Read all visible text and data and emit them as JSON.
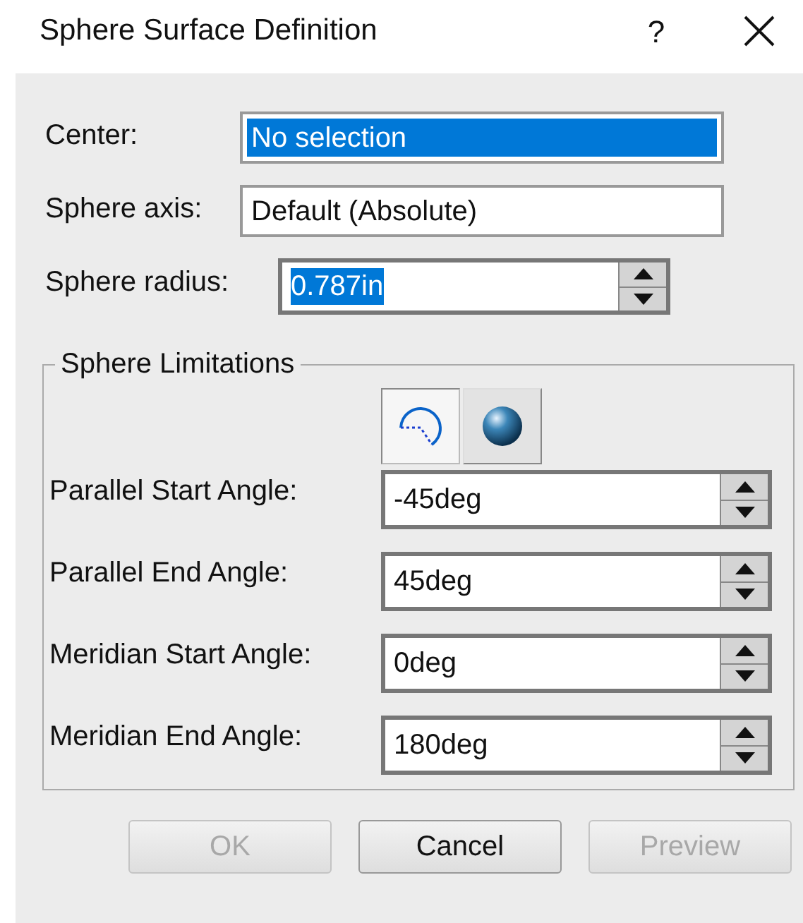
{
  "window": {
    "title": "Sphere Surface Definition",
    "help": "?"
  },
  "fields": [
    {
      "label": "Center:",
      "kind": "text",
      "value": "No selection",
      "selected": true
    },
    {
      "label": "Sphere axis:",
      "kind": "text",
      "value": "Default (Absolute)",
      "selected": false
    },
    {
      "label": "Sphere radius:",
      "kind": "spinner",
      "value": "0.787in",
      "selected": true
    }
  ],
  "limitations": {
    "title": "Sphere Limitations",
    "modes": [
      {
        "kind": "arc",
        "selected": true
      },
      {
        "kind": "sphere",
        "selected": false
      }
    ],
    "angles": [
      {
        "label": "Parallel Start Angle:",
        "value": "-45deg"
      },
      {
        "label": "Parallel End Angle:",
        "value": "45deg"
      },
      {
        "label": "Meridian Start Angle:",
        "value": "0deg"
      },
      {
        "label": "Meridian End Angle:",
        "value": "180deg"
      }
    ]
  },
  "buttons": [
    {
      "label": "OK",
      "disabled": true
    },
    {
      "label": "Cancel",
      "disabled": false
    },
    {
      "label": "Preview",
      "disabled": true
    }
  ]
}
